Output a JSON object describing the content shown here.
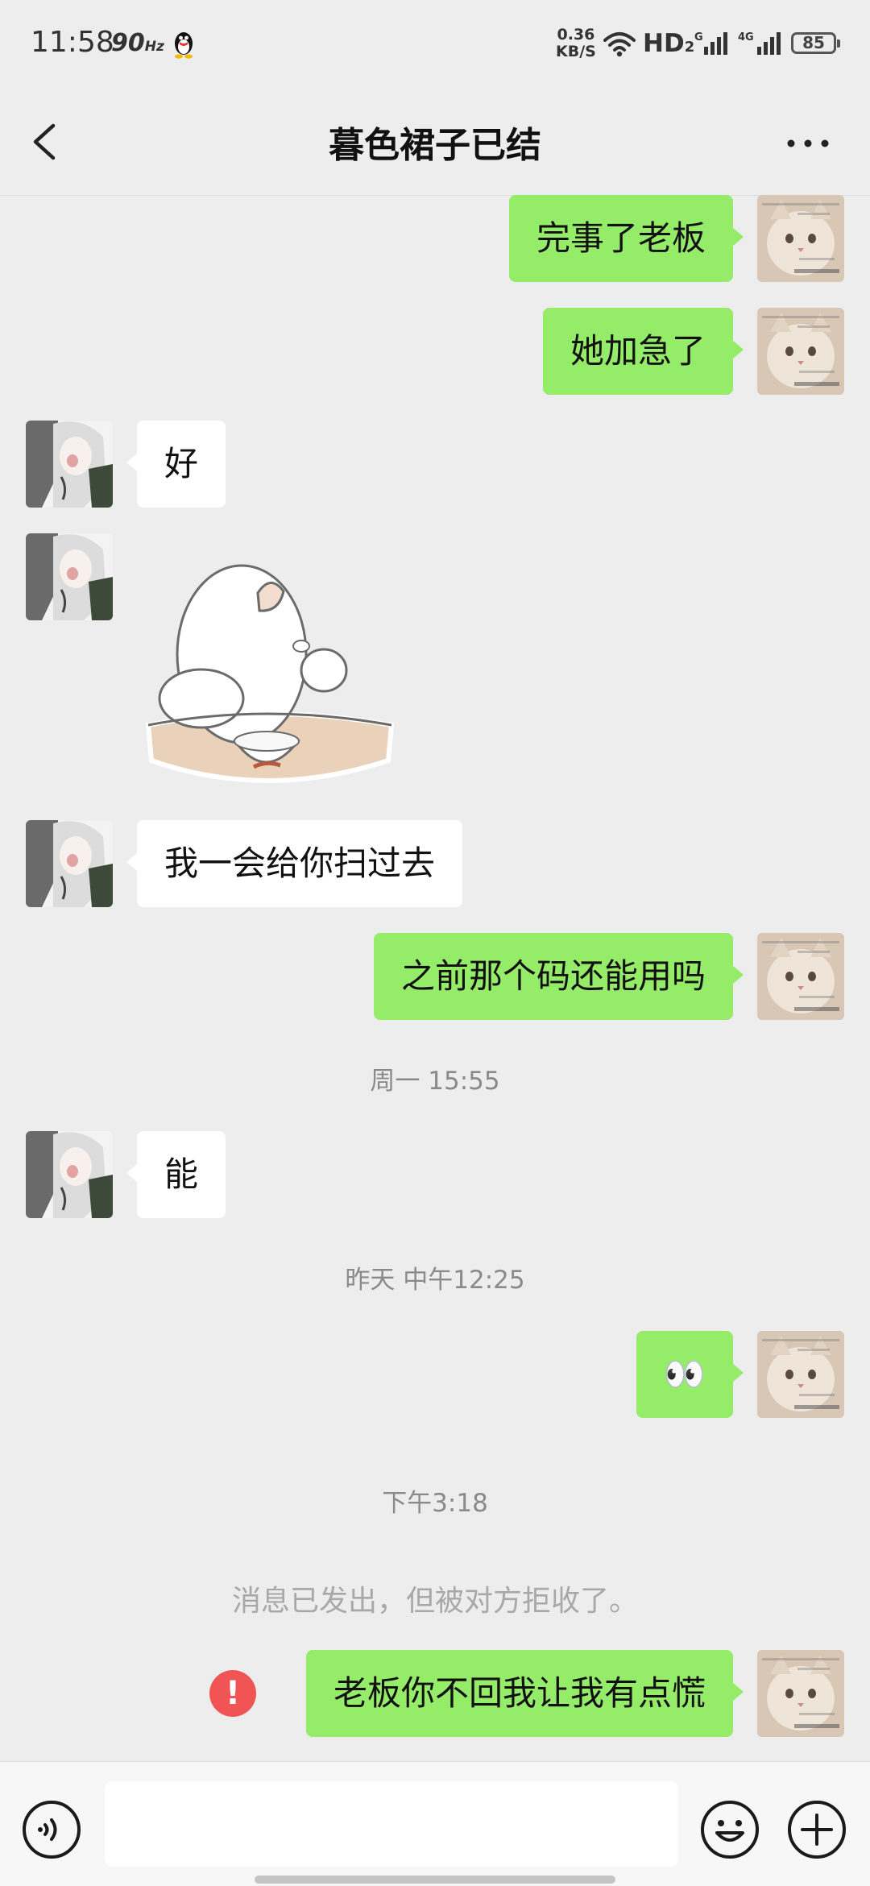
{
  "status_bar": {
    "time": "11:58",
    "refresh_rate": "90",
    "refresh_unit": "Hz",
    "net_speed_value": "0.36",
    "net_speed_unit": "KB/S",
    "hd_label": "HD",
    "hd_sub": "2",
    "sig1_label": "G",
    "sig2_label": "4G",
    "battery": "85"
  },
  "header": {
    "title": "暮色裙子已结",
    "back_icon": "chevron-left-icon",
    "more_icon": "more-horizontal-icon"
  },
  "messages": [
    {
      "side": "out",
      "text": "完事了老板"
    },
    {
      "side": "out",
      "text": "她加急了"
    },
    {
      "side": "in",
      "text": "好"
    },
    {
      "side": "in",
      "type": "sticker",
      "sticker": "white-cat-eating-rice-sticker"
    },
    {
      "side": "in",
      "text": "我一会给你扫过去"
    },
    {
      "side": "out",
      "text": "之前那个码还能用吗"
    },
    {
      "type": "time",
      "text": "周一 15:55"
    },
    {
      "side": "in",
      "text": "能"
    },
    {
      "type": "time",
      "text": "昨天 中午12:25"
    },
    {
      "side": "out",
      "text": "👀"
    },
    {
      "type": "time",
      "text": "下午3:18"
    },
    {
      "type": "system",
      "text": "消息已发出，但被对方拒收了。"
    },
    {
      "side": "out",
      "text": "老板你不回我让我有点慌",
      "failed": true,
      "error_icon_text": "!"
    }
  ],
  "input_bar": {
    "voice_icon": "voice-icon",
    "input_value": "",
    "emoji_icon": "emoji-icon",
    "plus_icon": "plus-icon"
  },
  "colors": {
    "outgoing_bubble": "#95ec69",
    "incoming_bubble": "#ffffff",
    "background": "#ededed",
    "error_red": "#f05454"
  }
}
